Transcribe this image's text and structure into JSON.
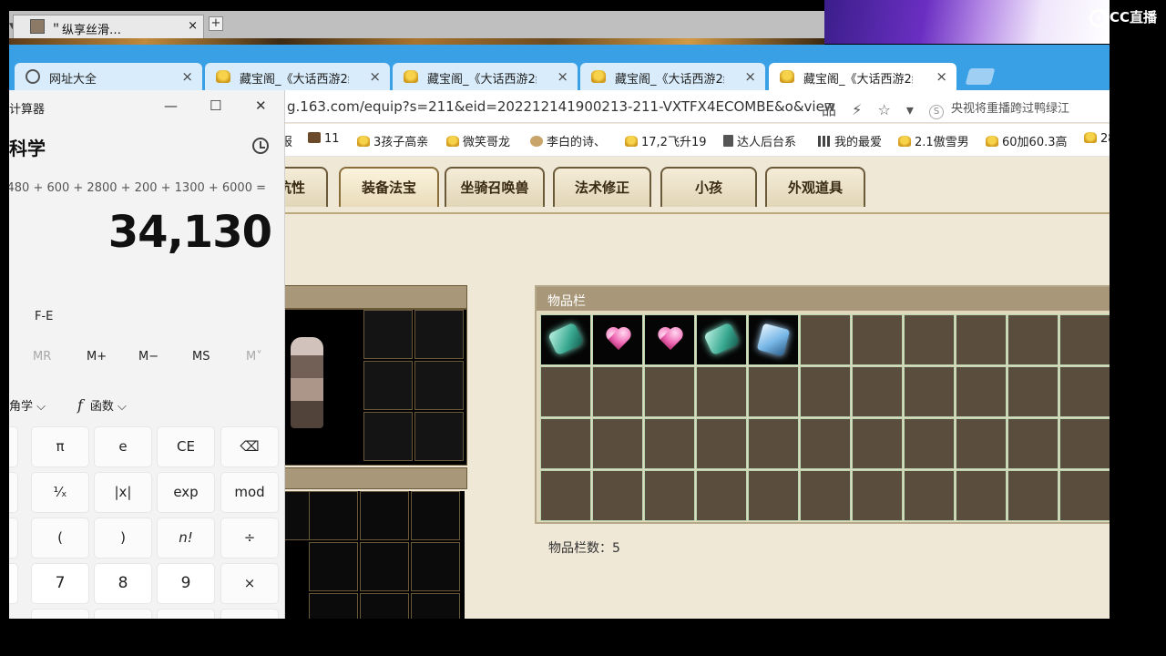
{
  "old_tab": {
    "title": "＂纵享丝滑…",
    "close": "×",
    "plus": "+"
  },
  "overlay_logo": "CC直播",
  "browser": {
    "tabs": [
      {
        "label": "网址大全",
        "icon": "globe-icon"
      },
      {
        "label": "藏宝阁_《大话西游2经典",
        "icon": "ding-icon"
      },
      {
        "label": "藏宝阁_《大话西游2经典",
        "icon": "ding-icon"
      },
      {
        "label": "藏宝阁_《大话西游2经典",
        "icon": "ding-icon"
      },
      {
        "label": "藏宝阁_《大话西游2经典",
        "icon": "ding-icon",
        "active": true
      }
    ],
    "tab_close": "×",
    "url": "g.163.com/equip?s=211&eid=202212141900213-211-VXTFX4ECOMBE&o&view",
    "addr_icons": [
      "品",
      "⚡",
      "☆",
      "▾"
    ],
    "search_badge": "S",
    "search_hint": "央视将重播跨过鸭绿江",
    "bookmarks": [
      "报",
      "11",
      "3孩子高亲",
      "微笑哥龙",
      "李白的诗、",
      "17,2飞升19",
      "达人后台系",
      "我的最爱",
      "2.1傲雪男",
      "60加60.3高",
      "28"
    ]
  },
  "page": {
    "category_tabs": [
      "抗性",
      "装备法宝",
      "坐骑召唤兽",
      "法术修正",
      "小孩",
      "外观道具"
    ],
    "active_tab": "装备法宝",
    "item_panel_title": "物品栏",
    "item_count_label": "物品栏数：5",
    "item_slots": [
      "gem",
      "heart",
      "heart",
      "gem",
      "cube"
    ]
  },
  "calculator": {
    "title": "计算器",
    "minimize": "—",
    "maximize": "☐",
    "close": "✕",
    "mode": "科学",
    "expression": "+ 480 + 600 + 2800 + 200 + 1300 + 6000 =",
    "result": "34,130",
    "fe": "F-E",
    "memory": [
      "MR",
      "M+",
      "M−",
      "MS",
      "M˅"
    ],
    "trig": "角学 ⌵",
    "func_symbol": "f",
    "func": "函数 ⌵",
    "keys_row1": [
      "π",
      "e",
      "CE",
      "⌫"
    ],
    "keys_row2": [
      "¹⁄ₓ",
      "|x|",
      "exp",
      "mod"
    ],
    "keys_row3": [
      "(",
      ")",
      "n!",
      "÷"
    ],
    "keys_row4": [
      "7",
      "8",
      "9",
      "×"
    ]
  }
}
